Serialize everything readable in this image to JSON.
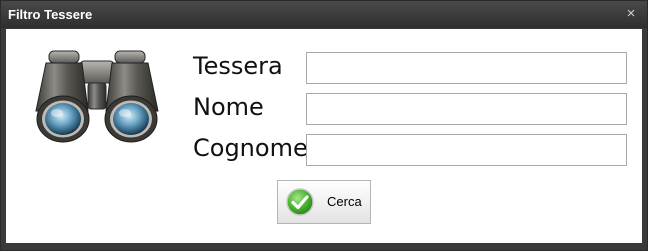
{
  "window": {
    "title": "Filtro Tessere",
    "close_symbol": "×"
  },
  "icons": {
    "binoculars": "binoculars-icon",
    "checkmark": "check-icon"
  },
  "form": {
    "fields": [
      {
        "label": "Tessera",
        "value": ""
      },
      {
        "label": "Nome",
        "value": ""
      },
      {
        "label": "Cognome",
        "value": ""
      }
    ]
  },
  "actions": {
    "search_label": "Cerca"
  },
  "colors": {
    "titlebar": "#333333",
    "check_green": "#3fae2a"
  }
}
